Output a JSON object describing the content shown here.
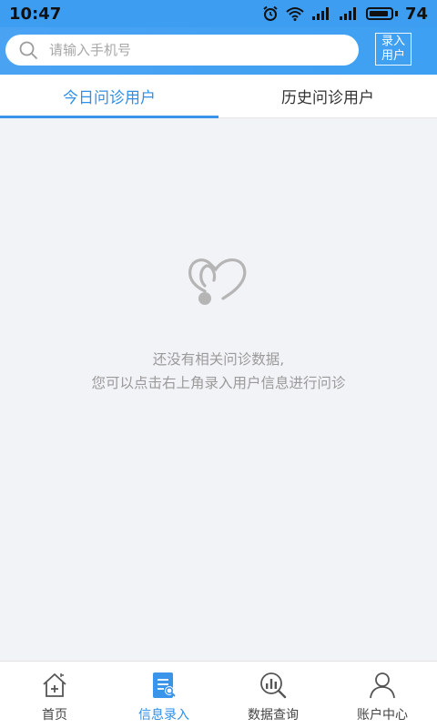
{
  "status_bar": {
    "time": "10:47",
    "battery": "74",
    "icons": [
      "alarm-icon",
      "wifi-icon",
      "signal-icon",
      "signal-icon",
      "battery-icon"
    ]
  },
  "search": {
    "placeholder": "请输入手机号",
    "value": ""
  },
  "add_user_button": {
    "line1": "录入",
    "line2": "用户"
  },
  "tabs": [
    {
      "label": "今日问诊用户",
      "active": true
    },
    {
      "label": "历史问诊用户",
      "active": false
    }
  ],
  "empty_state": {
    "icon": "stethoscope-heart-icon",
    "line1": "还没有相关问诊数据,",
    "line2": "您可以点击右上角录入用户信息进行问诊"
  },
  "bottom_nav": [
    {
      "label": "首页",
      "icon": "home-icon",
      "active": false
    },
    {
      "label": "信息录入",
      "icon": "document-icon",
      "active": true
    },
    {
      "label": "数据查询",
      "icon": "chart-search-icon",
      "active": false
    },
    {
      "label": "账户中心",
      "icon": "user-icon",
      "active": false
    }
  ],
  "colors": {
    "accent": "#2f8fe6",
    "header": "#3ea0f2",
    "background": "#f2f3f7"
  }
}
